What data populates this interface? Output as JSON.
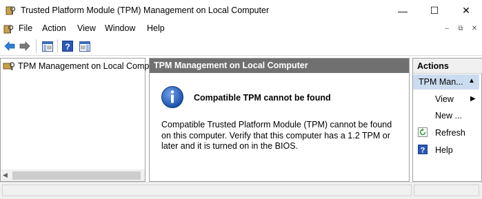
{
  "window": {
    "title": "Trusted Platform Module (TPM) Management on Local Computer",
    "controls": {
      "minimize": "—",
      "maximize": "☐",
      "close": "✕"
    }
  },
  "menubar": {
    "items": [
      "File",
      "Action",
      "View",
      "Window",
      "Help"
    ],
    "mdi": {
      "minimize": "–",
      "restore": "⧉",
      "close": "✕"
    }
  },
  "toolbar": {
    "icons": [
      "back-arrow-icon",
      "forward-arrow-icon",
      "show-hide-console-tree-icon",
      "help-icon",
      "show-hide-action-pane-icon"
    ]
  },
  "tree": {
    "root_label": "TPM Management on Local Comp"
  },
  "center": {
    "header": "TPM Management on Local Computer",
    "message_title": "Compatible TPM cannot be found",
    "message_body": "Compatible Trusted Platform Module (TPM) cannot be found on this computer. Verify that this computer has a 1.2 TPM or later and it is turned on in the BIOS."
  },
  "actions": {
    "header": "Actions",
    "group_label": "TPM Man...",
    "items": [
      {
        "label": "View",
        "submenu": "true"
      },
      {
        "label": "New ...",
        "submenu": "false"
      },
      {
        "label": "Refresh",
        "icon": "refresh-icon"
      },
      {
        "label": "Help",
        "icon": "help-icon"
      }
    ]
  },
  "colors": {
    "pane_header": "#707070",
    "selection": "#ccdcf0",
    "info_icon": "#1e5bb8"
  }
}
